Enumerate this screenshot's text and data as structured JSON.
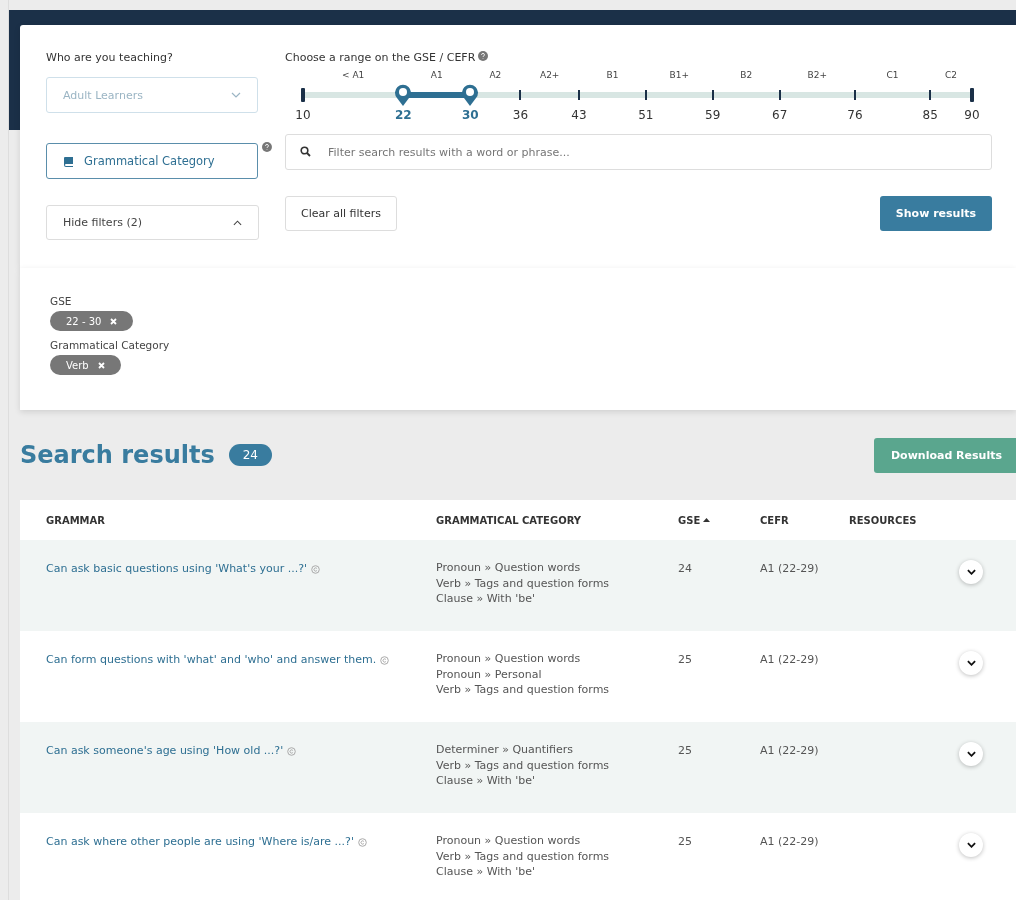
{
  "filters": {
    "audience": {
      "label": "Who are you teaching?",
      "value": "Adult Learners",
      "disabled": true
    },
    "range": {
      "label": "Choose a range on the GSE / CEFR",
      "bands": [
        "< A1",
        "A1",
        "A2",
        "A2+",
        "B1",
        "B1+",
        "B2",
        "B2+",
        "C1",
        "C2"
      ],
      "ticks": [
        {
          "label": "10",
          "level": 0,
          "kind": "end"
        },
        {
          "label": "22",
          "level": 0.15,
          "kind": "handle"
        },
        {
          "label": "30",
          "level": 0.25,
          "kind": "handle"
        },
        {
          "label": "36",
          "level": 0.325,
          "kind": "tick"
        },
        {
          "label": "43",
          "level": 0.4125,
          "kind": "tick"
        },
        {
          "label": "51",
          "level": 0.5125,
          "kind": "tick"
        },
        {
          "label": "59",
          "level": 0.6125,
          "kind": "tick"
        },
        {
          "label": "67",
          "level": 0.7125,
          "kind": "tick"
        },
        {
          "label": "76",
          "level": 0.825,
          "kind": "tick"
        },
        {
          "label": "85",
          "level": 0.9375,
          "kind": "tick"
        },
        {
          "label": "90",
          "level": 1,
          "kind": "end"
        }
      ]
    },
    "category_button": "Grammatical Category",
    "search": {
      "placeholder": "Filter search results with a word or phrase..."
    },
    "toggle": {
      "label": "Hide filters (2)",
      "expanded": true
    },
    "clear_button": "Clear all filters",
    "show_button": "Show results"
  },
  "active_filters": [
    {
      "label": "GSE",
      "chip": "22 - 30"
    },
    {
      "label": "Grammatical Category",
      "chip": "Verb"
    }
  ],
  "results": {
    "title": "Search results",
    "count": "24",
    "download_button": "Download Results",
    "columns": [
      {
        "label": "GRAMMAR",
        "sorted": false
      },
      {
        "label": "GRAMMATICAL CATEGORY",
        "sorted": false
      },
      {
        "label": "GSE",
        "sorted": true
      },
      {
        "label": "CEFR",
        "sorted": false
      },
      {
        "label": "RESOURCES",
        "sorted": false
      }
    ],
    "rows": [
      {
        "grammar": "Can ask basic questions using 'What's your ...?'",
        "categories": [
          "Pronoun » Question words",
          "Verb » Tags and question forms",
          "Clause » With 'be'"
        ],
        "gse": "24",
        "cefr": "A1 (22-29)"
      },
      {
        "grammar": "Can form questions with 'what' and 'who' and answer them.",
        "categories": [
          "Pronoun » Question words",
          "Pronoun » Personal",
          "Verb » Tags and question forms"
        ],
        "gse": "25",
        "cefr": "A1 (22-29)"
      },
      {
        "grammar": "Can ask someone's age using 'How old ...?'",
        "categories": [
          "Determiner » Quantifiers",
          "Verb » Tags and question forms",
          "Clause » With 'be'"
        ],
        "gse": "25",
        "cefr": "A1 (22-29)"
      },
      {
        "grammar": "Can ask where other people are using 'Where is/are ...?'",
        "categories": [
          "Pronoun » Question words",
          "Verb » Tags and question forms",
          "Clause » With 'be'"
        ],
        "gse": "25",
        "cefr": "A1 (22-29)"
      }
    ]
  }
}
